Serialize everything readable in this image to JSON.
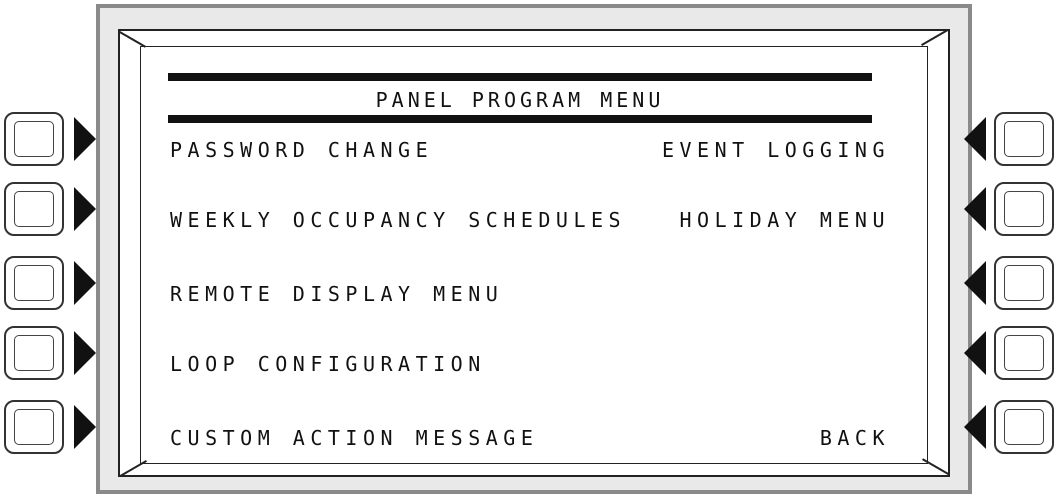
{
  "screen": {
    "title": "PANEL PROGRAM MENU",
    "left_items": [
      "PASSWORD CHANGE",
      "WEEKLY OCCUPANCY SCHEDULES",
      "REMOTE DISPLAY MENU",
      "LOOP CONFIGURATION",
      "CUSTOM ACTION MESSAGE"
    ],
    "right_items": [
      "EVENT LOGGING",
      "HOLIDAY MENU",
      "",
      "",
      "BACK"
    ]
  }
}
